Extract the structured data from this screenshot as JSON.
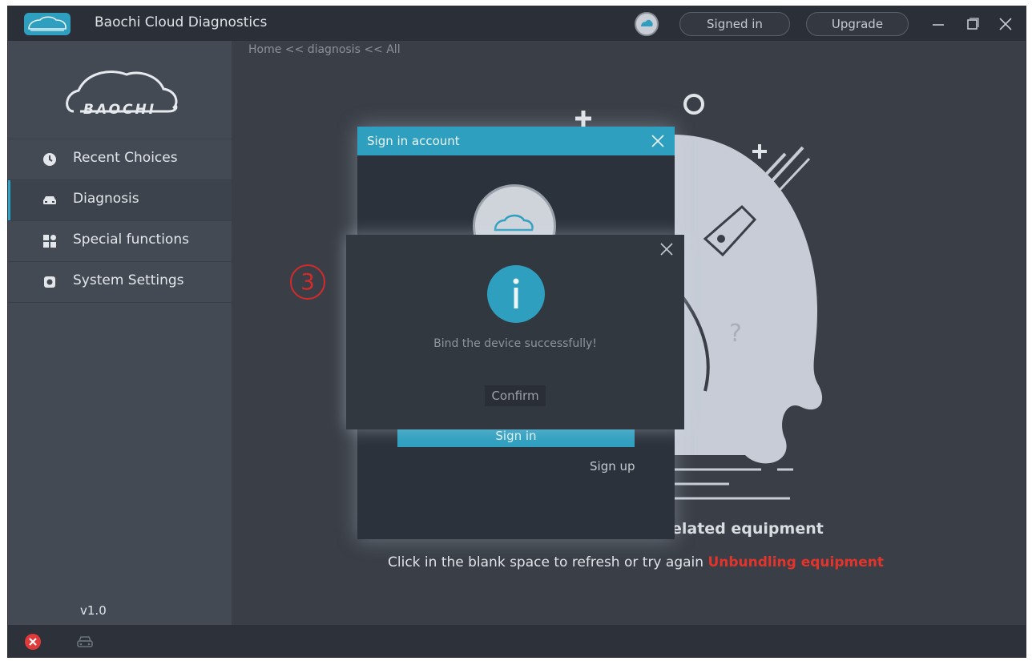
{
  "app": {
    "title": "Baochi Cloud Diagnostics",
    "logo_text": "BAOCHI"
  },
  "header": {
    "signed_in_label": "Signed in",
    "upgrade_label": "Upgrade"
  },
  "breadcrumb": "Home << diagnosis << All",
  "sidebar": {
    "brand_text": "BAOCHI",
    "items": [
      {
        "label": "Recent Choices",
        "icon": "clock-icon"
      },
      {
        "label": "Diagnosis",
        "icon": "car-icon",
        "active": true
      },
      {
        "label": "Special functions",
        "icon": "grid-icon"
      },
      {
        "label": "System Settings",
        "icon": "gear-icon"
      }
    ],
    "version": "v1.0"
  },
  "main": {
    "message_title": "elated equipment",
    "message_line": "Click in the blank space to refresh or try again",
    "message_link": "Unbundling equipment"
  },
  "annotation": {
    "step": "3"
  },
  "signin_dialog": {
    "title": "Sign in account",
    "signin_label": "Sign in",
    "signup_label": "Sign up"
  },
  "info_dialog": {
    "message": "Bind the device successfully!",
    "confirm_label": "Confirm"
  },
  "colors": {
    "accent": "#2f9fbf",
    "link_red": "#e3342c",
    "annotation_red": "#d42a2a",
    "background": "#3a3f47"
  }
}
